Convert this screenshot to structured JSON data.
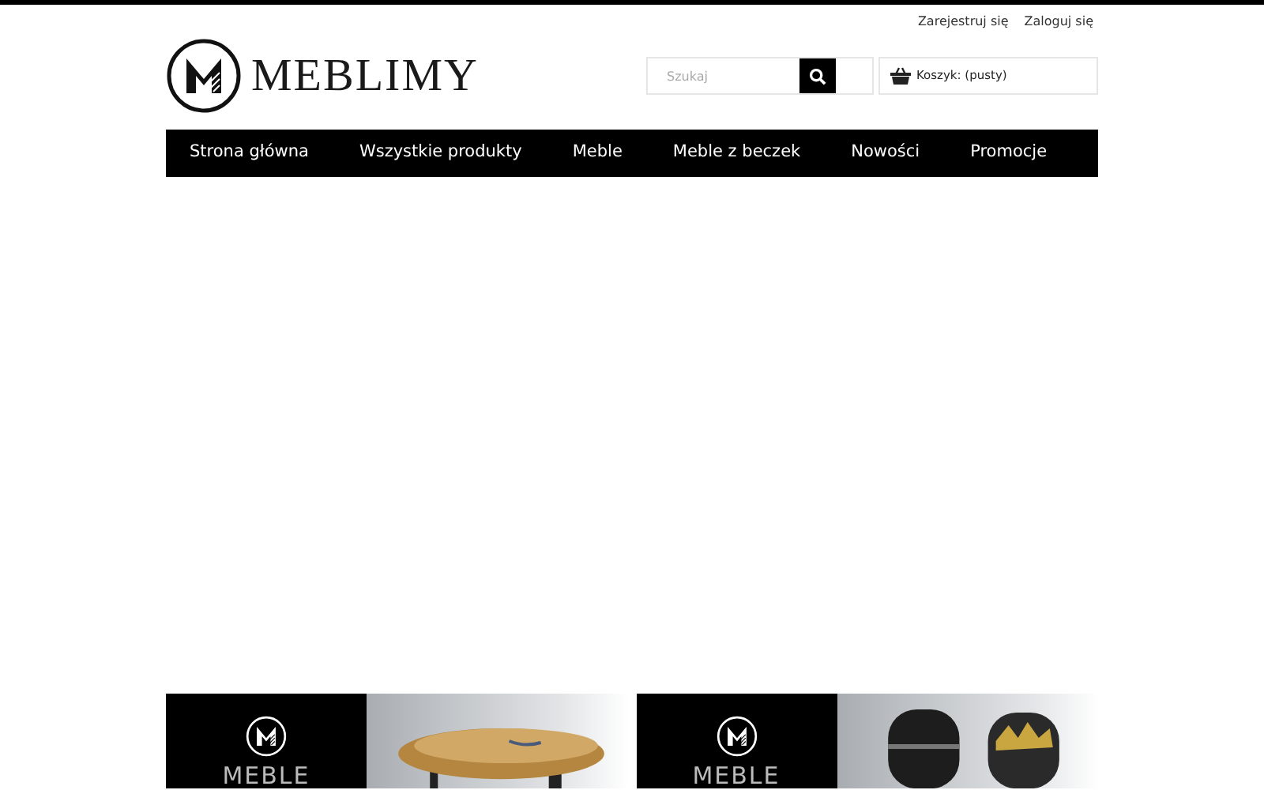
{
  "header": {
    "links": [
      "Zarejestruj się",
      "Zaloguj się"
    ],
    "logo_text": "MEBLIMY",
    "search": {
      "placeholder": "Szukaj"
    },
    "cart": "Koszyk: (pusty)"
  },
  "nav": [
    "Strona główna",
    "Wszystkie produkty",
    "Meble",
    "Meble z beczek",
    "Nowości",
    "Promocje"
  ],
  "banners": [
    {
      "title": "MEBLE"
    },
    {
      "title": "MEBLE"
    }
  ]
}
